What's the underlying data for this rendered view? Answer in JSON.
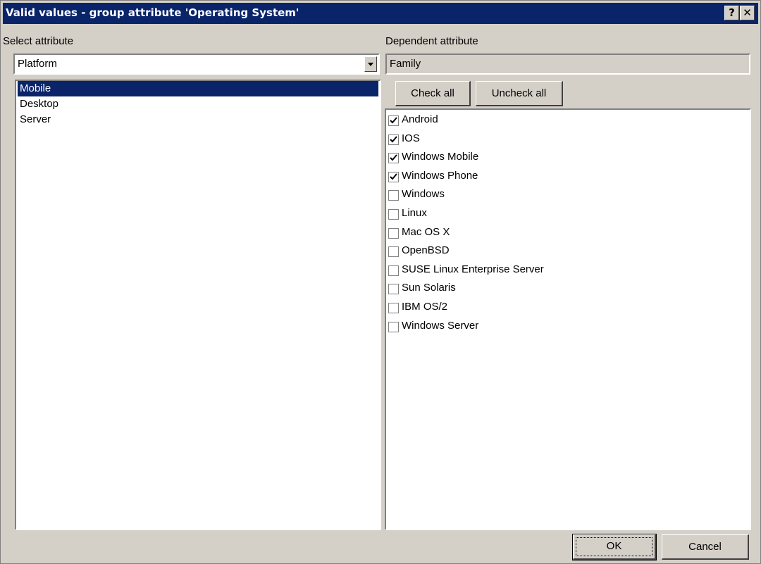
{
  "window": {
    "title": "Valid values - group attribute 'Operating System'",
    "help_label": "?",
    "close_label": "✕"
  },
  "left": {
    "label": "Select attribute",
    "combo_value": "Platform",
    "items": [
      {
        "label": "Mobile",
        "selected": true
      },
      {
        "label": "Desktop",
        "selected": false
      },
      {
        "label": "Server",
        "selected": false
      }
    ]
  },
  "right": {
    "label": "Dependent attribute",
    "field_value": "Family",
    "check_all_label": "Check all",
    "uncheck_all_label": "Uncheck all",
    "checks": [
      {
        "label": "Android",
        "checked": true
      },
      {
        "label": "IOS",
        "checked": true
      },
      {
        "label": "Windows Mobile",
        "checked": true
      },
      {
        "label": "Windows Phone",
        "checked": true
      },
      {
        "label": "Windows",
        "checked": false
      },
      {
        "label": "Linux",
        "checked": false
      },
      {
        "label": "Mac OS X",
        "checked": false
      },
      {
        "label": "OpenBSD",
        "checked": false
      },
      {
        "label": "SUSE Linux Enterprise Server",
        "checked": false
      },
      {
        "label": "Sun Solaris",
        "checked": false
      },
      {
        "label": "IBM OS/2",
        "checked": false
      },
      {
        "label": "Windows Server",
        "checked": false
      }
    ]
  },
  "footer": {
    "ok_label": "OK",
    "cancel_label": "Cancel"
  },
  "colors": {
    "titlebar": "#0a246a",
    "face": "#d4d0c8",
    "selection": "#0a246a"
  }
}
